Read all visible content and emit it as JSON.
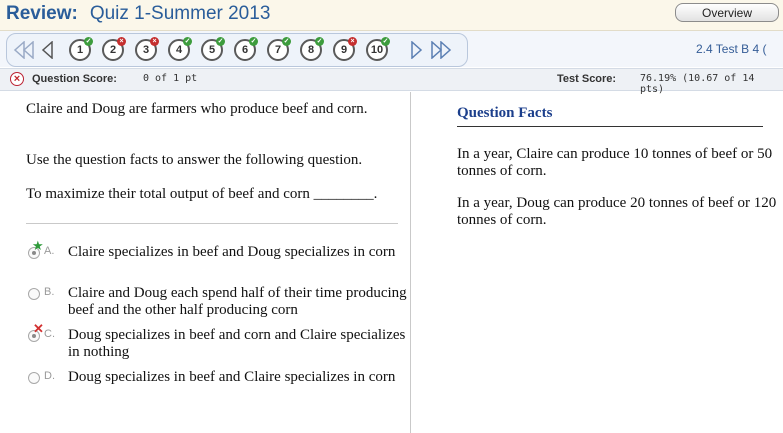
{
  "header": {
    "review_label": "Review:",
    "quiz_title": "Quiz 1-Summer 2013",
    "overview_button": "Overview"
  },
  "nav": {
    "questions": [
      {
        "num": "1",
        "status": "correct"
      },
      {
        "num": "2",
        "status": "incorrect"
      },
      {
        "num": "3",
        "status": "incorrect"
      },
      {
        "num": "4",
        "status": "correct"
      },
      {
        "num": "5",
        "status": "correct"
      },
      {
        "num": "6",
        "status": "correct"
      },
      {
        "num": "7",
        "status": "correct"
      },
      {
        "num": "8",
        "status": "correct"
      },
      {
        "num": "9",
        "status": "incorrect"
      },
      {
        "num": "10",
        "status": "correct"
      }
    ],
    "test_label": "2.4 Test B 4 ("
  },
  "score": {
    "question_score_label": "Question Score:",
    "question_score_value": "0 of 1 pt",
    "test_score_label": "Test Score:",
    "test_score_value": "76.19% (10.67 of 14 pts)"
  },
  "question": {
    "intro": "Claire and Doug are farmers who produce beef and corn.",
    "instruction": "Use the question facts to answer the following question.",
    "prompt": "To maximize their total output of beef and corn ________.",
    "options": [
      {
        "letter": "A.",
        "text": "Claire specializes in beef and Doug specializes in corn",
        "mark": "correct-star"
      },
      {
        "letter": "B.",
        "text": "Claire and Doug each spend half of their time producing beef and the other half producing corn",
        "mark": ""
      },
      {
        "letter": "C.",
        "text": "Doug specializes in beef and corn and Claire specializes in nothing",
        "mark": "selected-wrong"
      },
      {
        "letter": "D.",
        "text": "Doug specializes in beef and Claire specializes in corn",
        "mark": ""
      }
    ]
  },
  "facts": {
    "title": "Question Facts",
    "items": [
      "In a year, Claire can produce 10 tonnes of beef or 50 tonnes of corn.",
      "In a year, Doug can produce 20 tonnes of beef or 120 tonnes of corn."
    ]
  },
  "colors": {
    "accent_blue": "#2a5d9a",
    "facts_title": "#1c3f8c",
    "correct_green": "#2e9a3a",
    "wrong_red": "#d23030"
  }
}
